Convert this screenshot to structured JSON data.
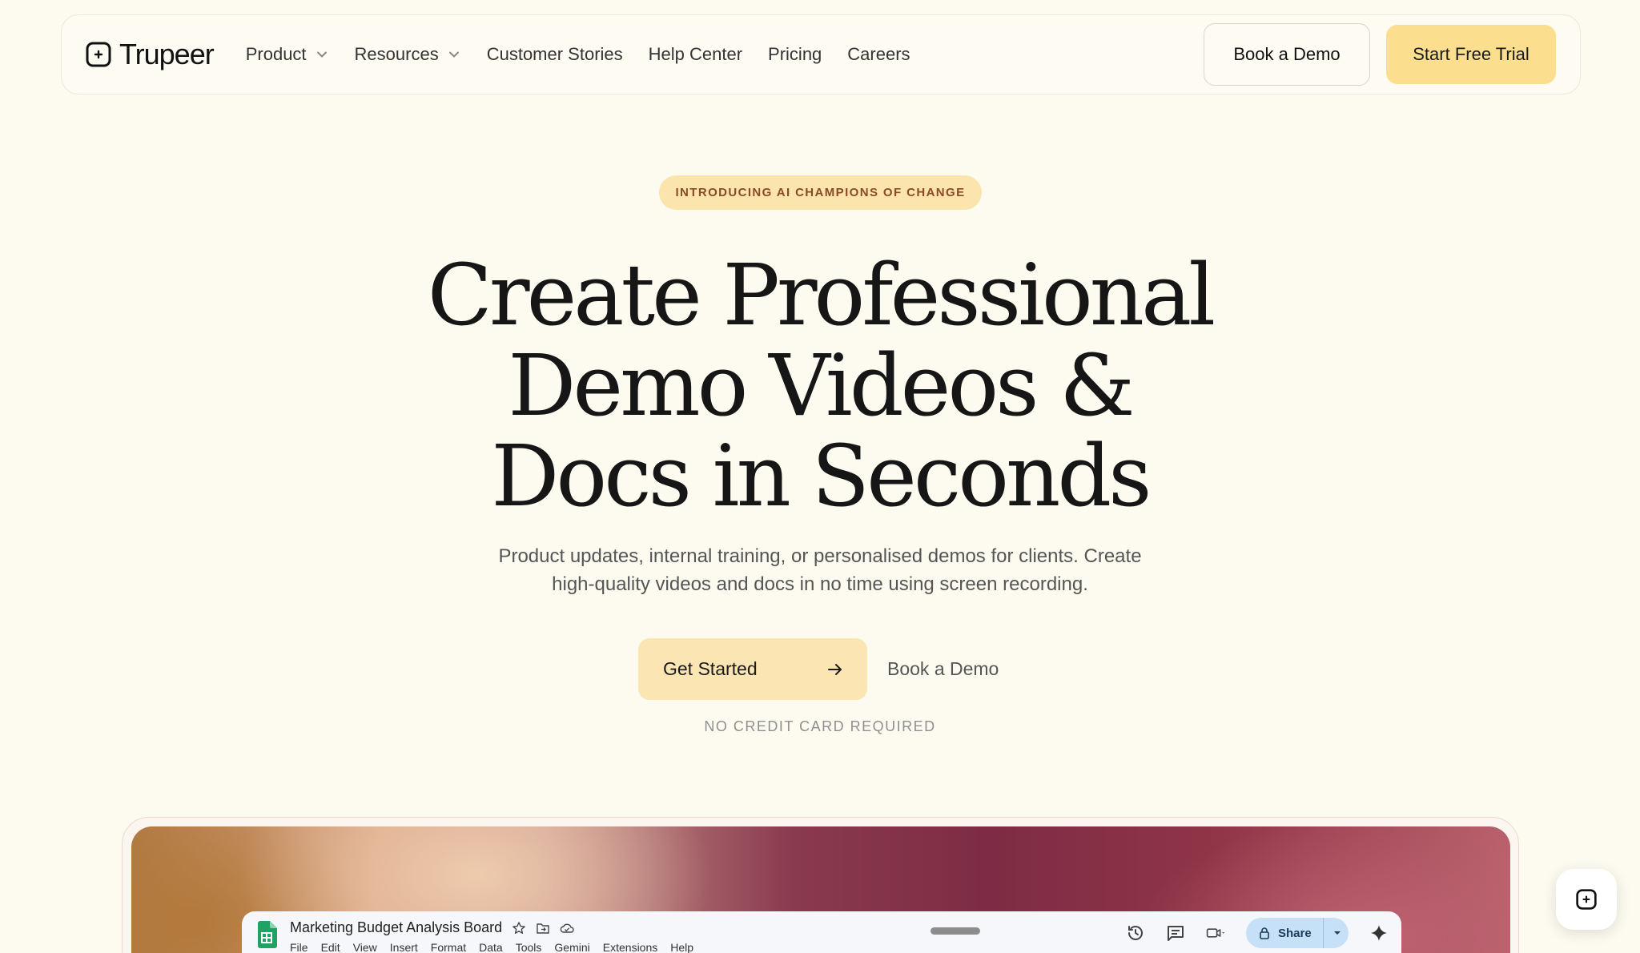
{
  "brand": {
    "name": "Trupeer",
    "icon": "trupeer-logo-icon"
  },
  "nav": {
    "items": [
      {
        "label": "Product",
        "has_dropdown": true
      },
      {
        "label": "Resources",
        "has_dropdown": true
      },
      {
        "label": "Customer Stories",
        "has_dropdown": false
      },
      {
        "label": "Help Center",
        "has_dropdown": false
      },
      {
        "label": "Pricing",
        "has_dropdown": false
      },
      {
        "label": "Careers",
        "has_dropdown": false
      }
    ],
    "book_demo_label": "Book a Demo",
    "start_trial_label": "Start Free Trial"
  },
  "hero": {
    "badge": "INTRODUCING AI CHAMPIONS OF CHANGE",
    "headline_lines": [
      "Create Professional",
      "Demo Videos &",
      "Docs in Seconds"
    ],
    "subtitle_lines": [
      "Product updates, internal training, or personalised demos for clients. Create",
      "high-quality videos and docs in no time using screen recording."
    ],
    "cta_primary": "Get Started",
    "cta_secondary": "Book a Demo",
    "note": "NO CREDIT CARD REQUIRED"
  },
  "preview": {
    "sheet_title": "Marketing Budget Analysis Board",
    "menu": [
      "File",
      "Edit",
      "View",
      "Insert",
      "Format",
      "Data",
      "Tools",
      "Gemini",
      "Extensions",
      "Help"
    ],
    "share_label": "Share",
    "icons": [
      "sheets-logo-icon",
      "star-icon",
      "move-folder-icon",
      "cloud-status-icon",
      "history-icon",
      "comments-icon",
      "meet-icon",
      "lock-icon",
      "gemini-sparkle-icon"
    ]
  },
  "colors": {
    "background": "#fdfbf0",
    "accent_yellow": "#fbdf8f",
    "badge_bg": "#fbe5ad",
    "badge_text": "#8a4a26"
  }
}
